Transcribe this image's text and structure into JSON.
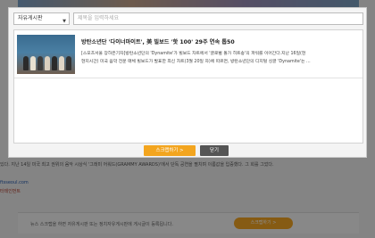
{
  "search": {
    "board_selected": "자유게시판",
    "placeholder": "제목을 입력하세요"
  },
  "result": {
    "title": "방탄소년단 '다이너마이트', 美 빌보드 '핫 100' 29주 연속 톱50",
    "body_line1": "[스포츠서울 장하은기자]방탄소년단의 'Dynamite'가 빌보드 차트에서 '글로벌 돌가 히트송'의 파워를 이어간다.지난 16일(현",
    "body_line2": "현지시간) 미국 음악 전문 매체 빌보드가 발표한 최신 차트(3월 20일 자)에 따르면, 방탄소년단의 디지털 싱글 'Dynamite'는 ..."
  },
  "buttons": {
    "scrap": "스크랩하기 >",
    "close": "닫기"
  },
  "background": {
    "article_line": "있다. 지난 14일 미국 최고 권위의 음악 시상식 '그래미 어워드(GRAMMY AWARDS)'에서 단독 공연을 펼치며 이름값을 입증했다. 그 희를 그었다.",
    "link": "ftsseoul.com",
    "ent": "터테인먼트",
    "footer_text": "뉴스 스크랩을 하면 자유게시판 또는 정치자유게시판에 게시글이 등록됩니다.",
    "footer_button": "스크랩하기 >"
  }
}
